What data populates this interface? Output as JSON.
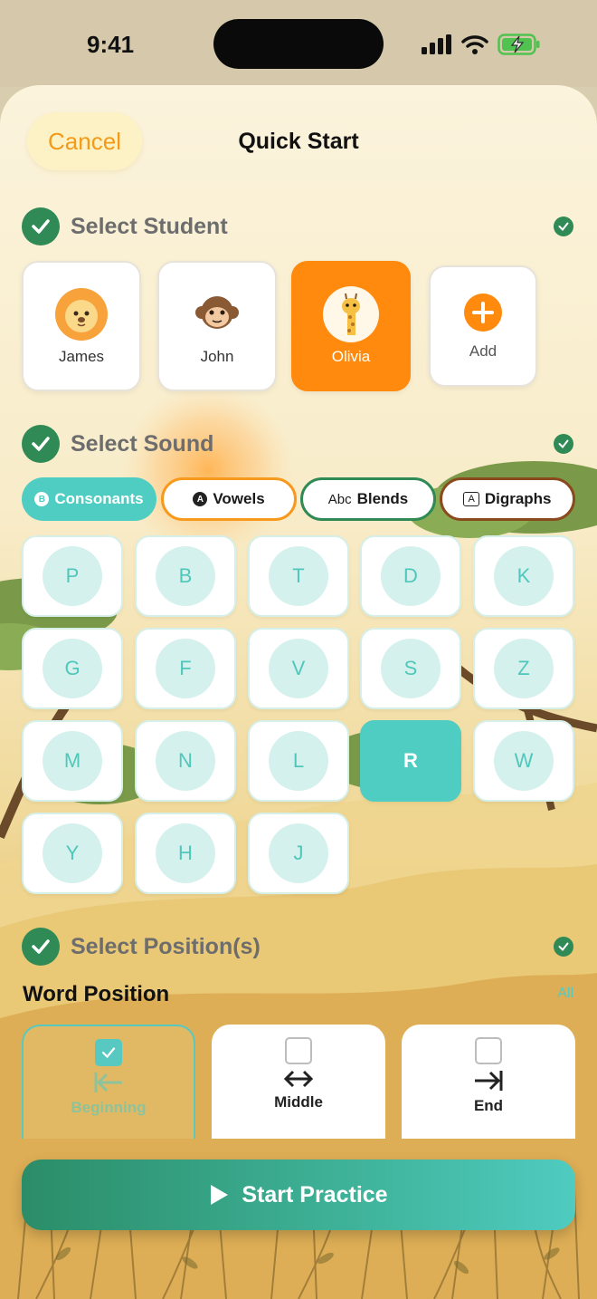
{
  "status_bar": {
    "time": "9:41"
  },
  "header": {
    "cancel_label": "Cancel",
    "title": "Quick Start"
  },
  "sections": {
    "student": "Select Student",
    "sound": "Select Sound",
    "position": "Select Position(s)"
  },
  "students": [
    {
      "name": "James",
      "avatar": "lion-icon",
      "selected": false
    },
    {
      "name": "John",
      "avatar": "monkey-icon",
      "selected": false
    },
    {
      "name": "Olivia",
      "avatar": "giraffe-icon",
      "selected": true
    }
  ],
  "add_student_label": "Add",
  "sound_tabs": [
    {
      "label": "Consonants",
      "badge": "B",
      "selected": true
    },
    {
      "label": "Vowels",
      "badge": "A",
      "selected": false
    },
    {
      "label": "Blends",
      "badge": "Abc",
      "selected": false
    },
    {
      "label": "Digraphs",
      "badge": "A",
      "selected": false
    }
  ],
  "letters": [
    "P",
    "B",
    "T",
    "D",
    "K",
    "G",
    "F",
    "V",
    "S",
    "Z",
    "M",
    "N",
    "L",
    "R",
    "W",
    "Y",
    "H",
    "J"
  ],
  "selected_letter": "R",
  "word_position": {
    "label": "Word Position",
    "all_label": "All",
    "options": [
      {
        "label": "Beginning",
        "icon": "arrow-to-left-icon",
        "checked": true
      },
      {
        "label": "Middle",
        "icon": "arrow-left-right-icon",
        "checked": false
      },
      {
        "label": "End",
        "icon": "arrow-to-right-icon",
        "checked": false
      }
    ]
  },
  "start_button": {
    "label": "Start Practice"
  },
  "colors": {
    "accent_green": "#2f8a55",
    "accent_orange": "#ff8a0e",
    "accent_teal": "#50cdc2",
    "cancel_text": "#f39a1a"
  }
}
